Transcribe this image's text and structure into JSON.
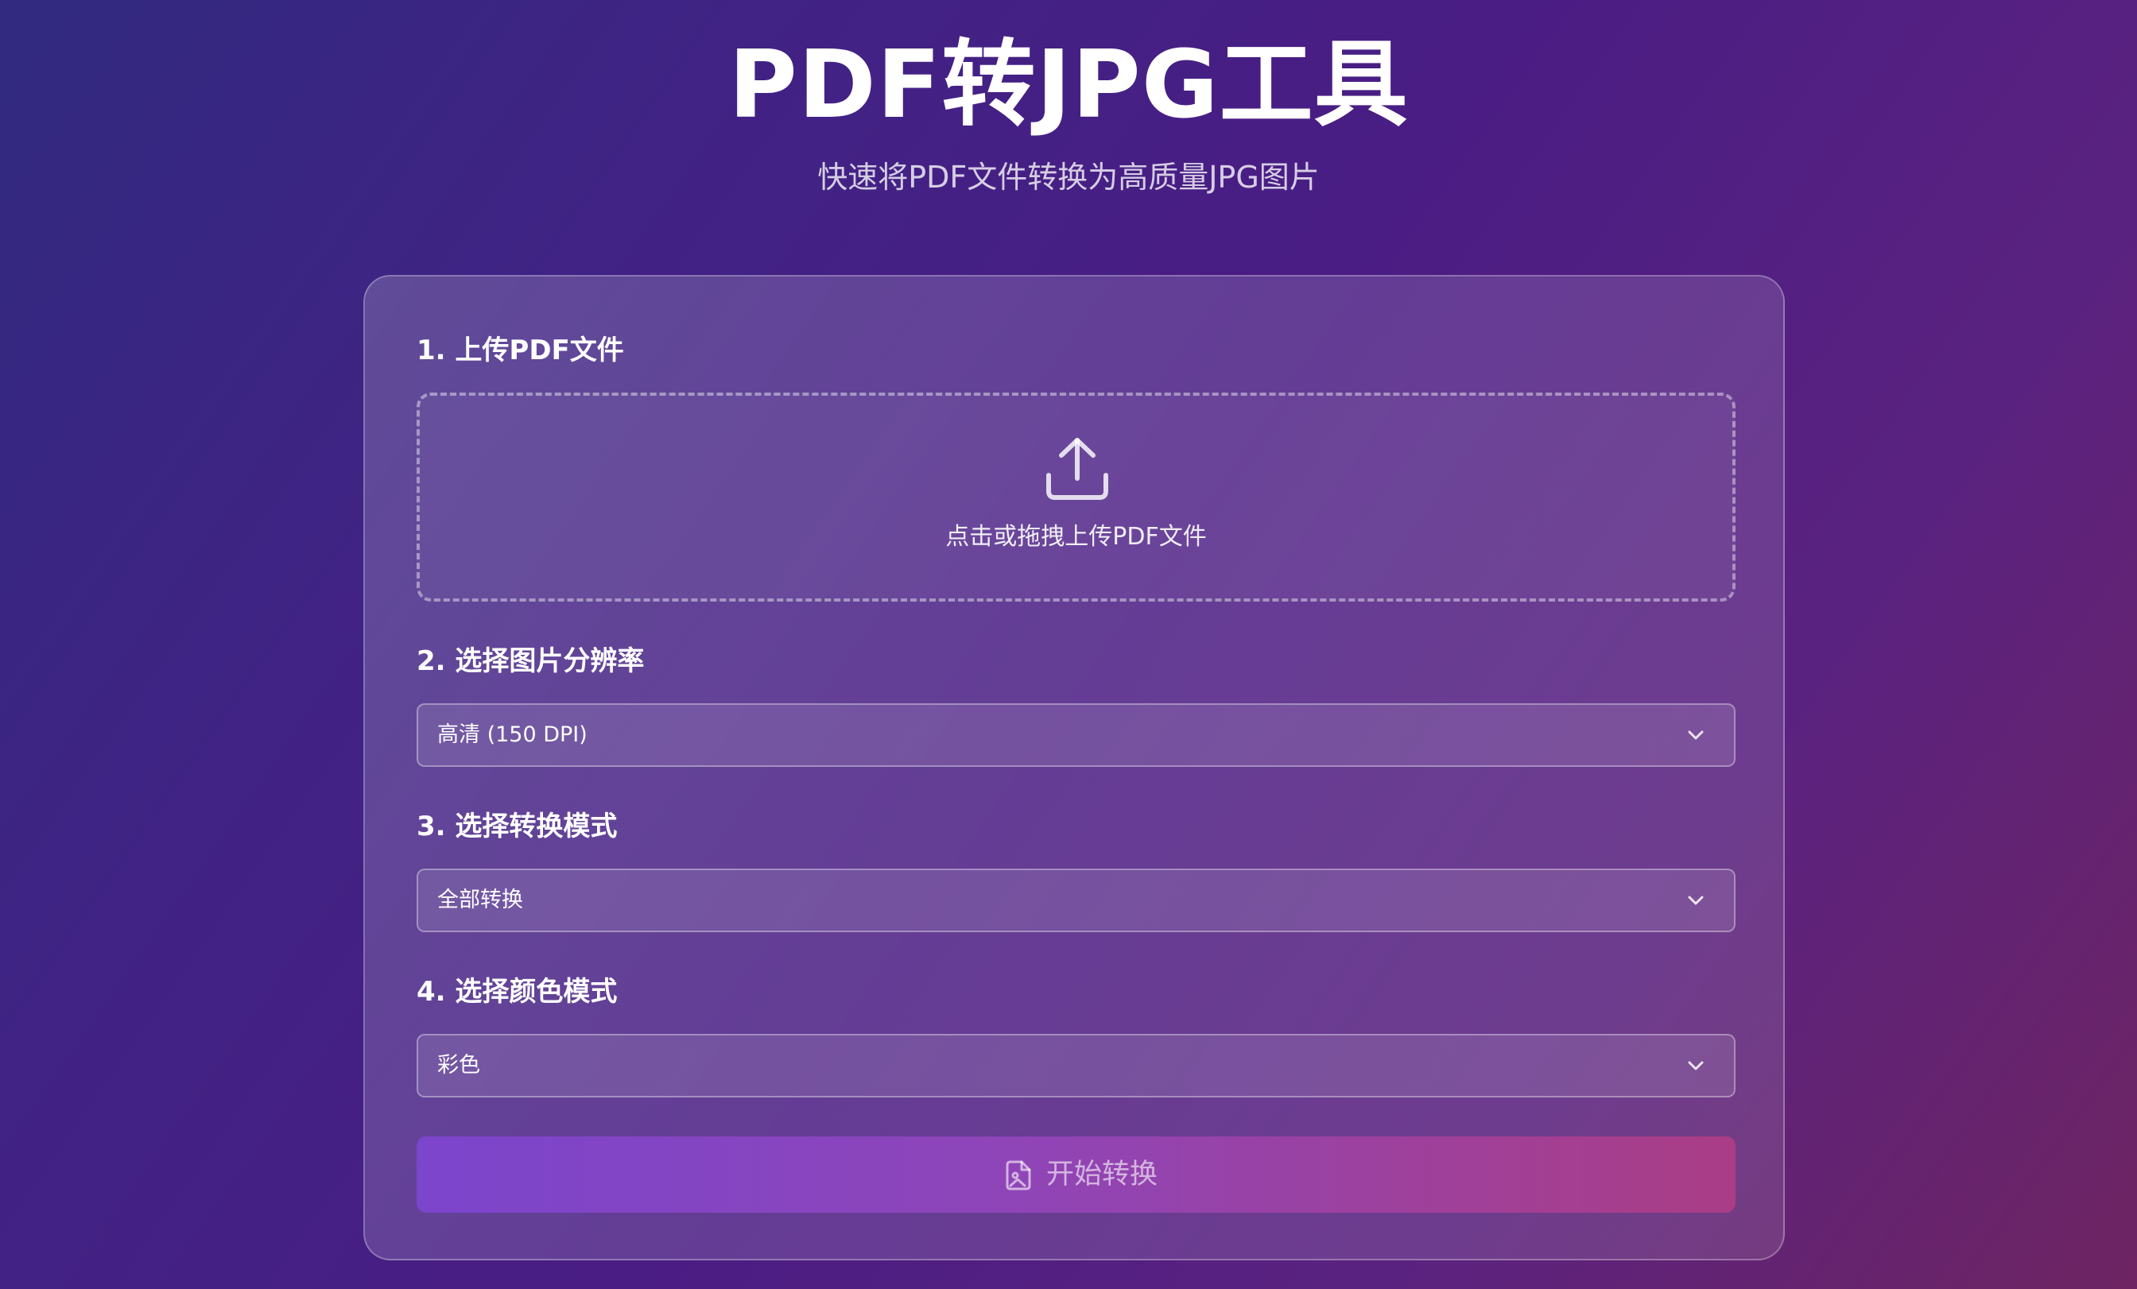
{
  "header": {
    "title": "PDF转JPG工具",
    "subtitle": "快速将PDF文件转换为高质量JPG图片"
  },
  "upload": {
    "label": "1. 上传PDF文件",
    "prompt": "点击或拖拽上传PDF文件",
    "icon": "upload-icon"
  },
  "resolution": {
    "label": "2. 选择图片分辨率",
    "selected": "高清 (150 DPI)"
  },
  "mode": {
    "label": "3. 选择转换模式",
    "selected": "全部转换"
  },
  "color": {
    "label": "4. 选择颜色模式",
    "selected": "彩色"
  },
  "convert": {
    "label": "开始转换",
    "icon": "file-image-icon"
  },
  "colors": {
    "background_start": "#312a80",
    "background_end": "#6e2462",
    "button_start": "#7b45cc",
    "button_end": "#aa3d86"
  }
}
